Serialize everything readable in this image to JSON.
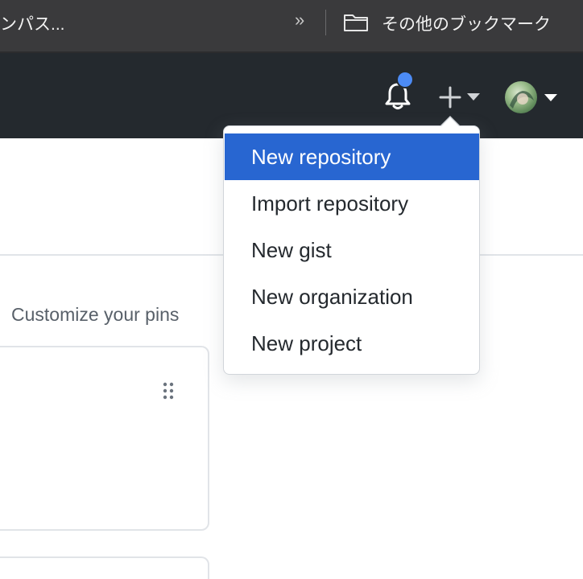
{
  "browser": {
    "bookmark_left_label": "ンパス...",
    "overflow_chevron": "»",
    "other_bookmarks_label": "その他のブックマーク"
  },
  "header": {
    "icons": [
      "bell-icon",
      "plus-icon",
      "avatar"
    ],
    "notification_dot_color": "#4c8bf5"
  },
  "create_menu": {
    "items": [
      {
        "label": "New repository",
        "active": true
      },
      {
        "label": "Import repository",
        "active": false
      },
      {
        "label": "New gist",
        "active": false
      },
      {
        "label": "New organization",
        "active": false
      },
      {
        "label": "New project",
        "active": false
      }
    ]
  },
  "pins": {
    "customize_label": "Customize your pins"
  },
  "colors": {
    "header_bg": "#24292e",
    "bookmarks_bg": "#3a3a3c",
    "menu_active_bg": "#2866d1"
  }
}
